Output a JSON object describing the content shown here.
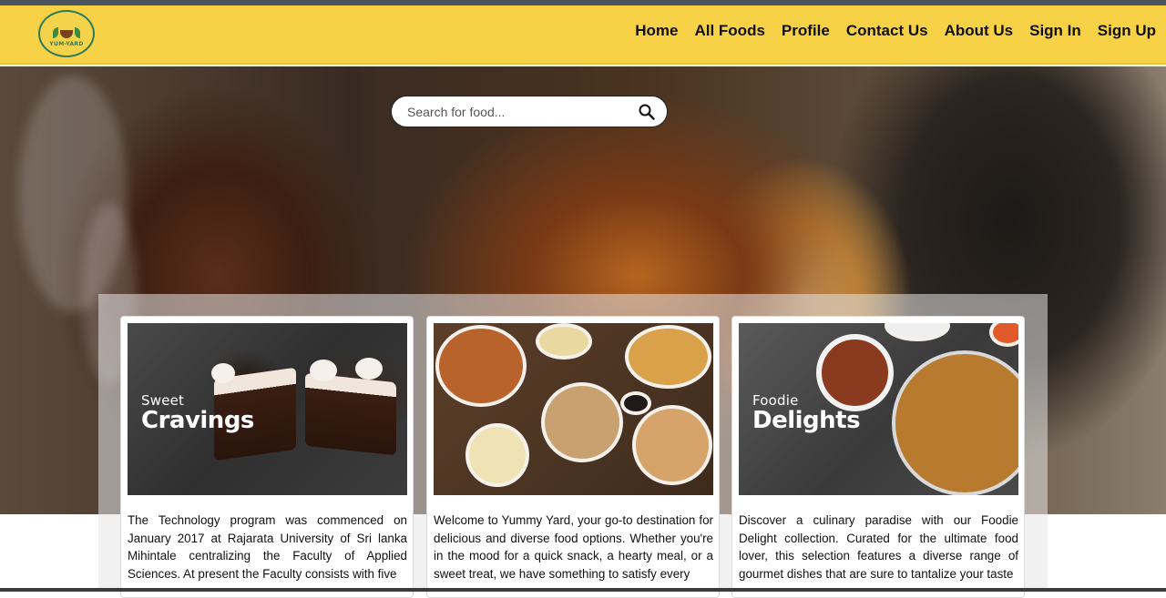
{
  "brand": {
    "logo_text": "YUM-YARD"
  },
  "nav": {
    "items": [
      "Home",
      "All Foods",
      "Profile",
      "Contact Us",
      "About Us",
      "Sign In",
      "Sign Up"
    ]
  },
  "search": {
    "placeholder": "Search for food..."
  },
  "cards": [
    {
      "overlay_small": "Sweet",
      "overlay_big": "Cravings",
      "description": "The Technology program was commenced on January 2017 at Rajarata University of Sri lanka Mihintale centralizing the Faculty of Applied Sciences. At present the Faculty consists with five"
    },
    {
      "overlay_small": "",
      "overlay_big": "",
      "description": "Welcome to Yummy Yard, your go-to destination for delicious and diverse food options. Whether you're in the mood for a quick snack, a hearty meal, or a sweet treat, we have something to satisfy every"
    },
    {
      "overlay_small": "Foodie",
      "overlay_big": "Delights",
      "description": "Discover a culinary paradise with our Foodie Delight collection. Curated for the ultimate food lover, this selection features a diverse range of gourmet dishes that are sure to tantalize your taste"
    }
  ],
  "colors": {
    "navbar": "#f7d146",
    "text": "#111111"
  }
}
